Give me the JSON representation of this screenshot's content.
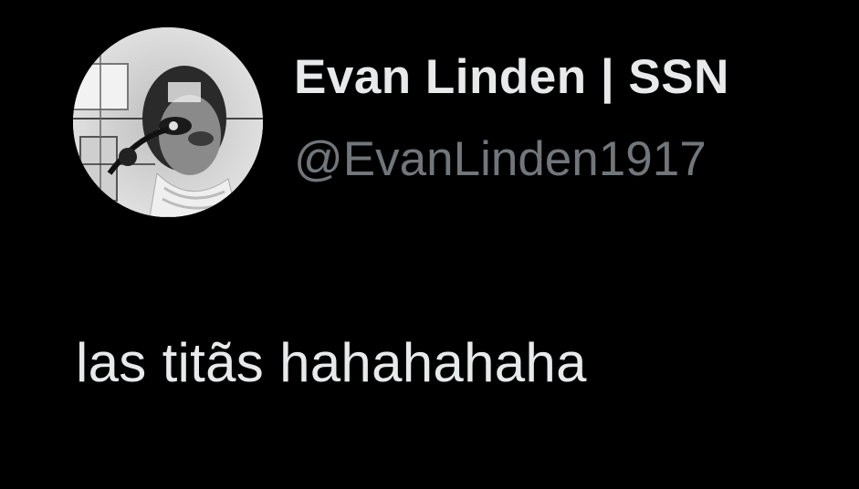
{
  "tweet": {
    "author": {
      "display_name": "Evan Linden | SSN",
      "handle": "@EvanLinden1917",
      "avatar_icon": "profile-photo"
    },
    "text": "las titãs hahahahaha"
  },
  "theme": {
    "background": "#000000",
    "primary_text": "#e7e9ea",
    "secondary_text": "#71767b"
  }
}
